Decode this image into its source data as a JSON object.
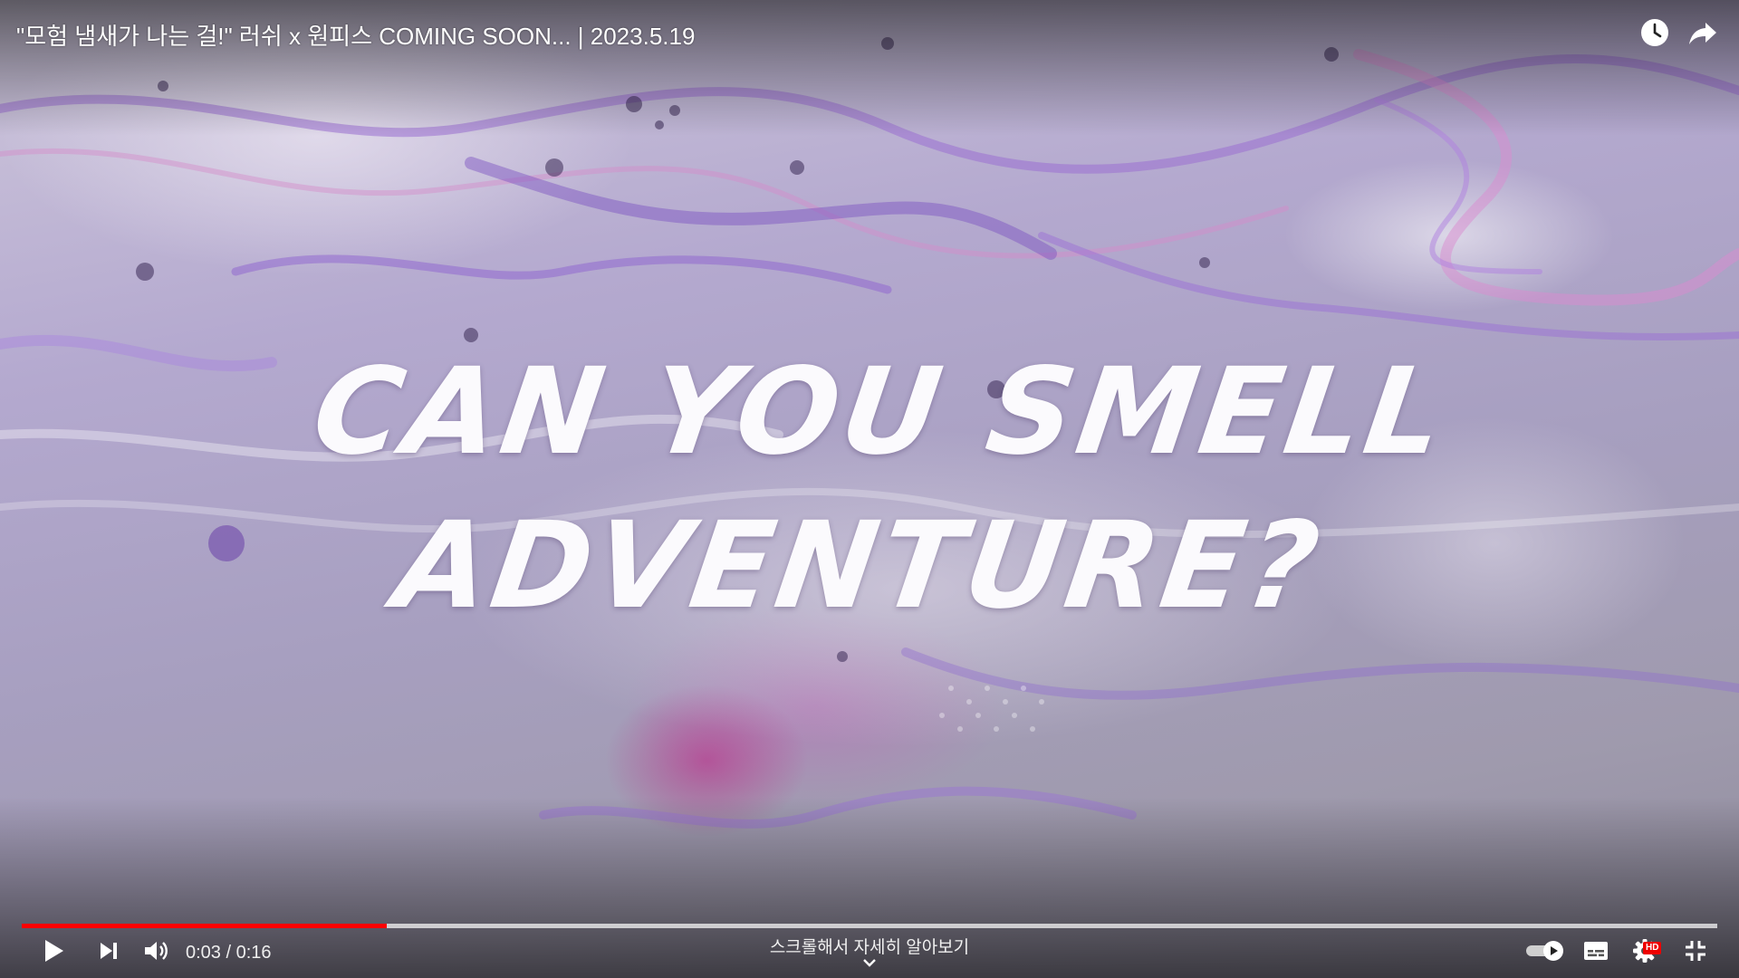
{
  "video": {
    "title": "\"모험 냄새가 나는 걸!\" 러쉬 x 원피스 COMING SOON... | 2023.5.19",
    "overlay_line1": "CAN YOU SMELL",
    "overlay_line2": "ADVENTURE?"
  },
  "top_actions": [
    {
      "name": "watch-later",
      "icon": "clock-icon"
    },
    {
      "name": "share",
      "icon": "share-arrow-icon"
    }
  ],
  "player": {
    "current_time": "0:03",
    "duration": "0:16",
    "time_display": "0:03 / 0:16",
    "progress_played_fraction": 0.2155,
    "progress_loaded_fraction": 1.0,
    "scroll_hint": "스크롤해서 자세히 알아보기",
    "hd_badge": "HD",
    "autoplay_on": true
  },
  "controls": {
    "left": [
      "play-icon",
      "next-icon",
      "volume-icon"
    ],
    "right": [
      "autoplay-toggle",
      "subtitles-icon",
      "settings-gear-icon",
      "exit-fullscreen-icon"
    ]
  },
  "colors": {
    "progress_played": "#ff0000",
    "hd_badge": "#ee0000"
  }
}
